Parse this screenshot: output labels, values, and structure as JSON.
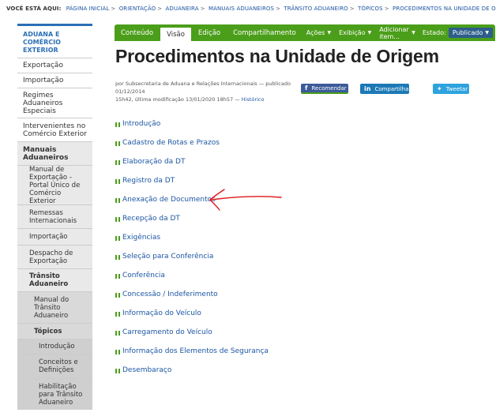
{
  "breadcrumb": {
    "label": "VOCÊ ESTÁ AQUI:",
    "items": [
      "PÁGINA INICIAL",
      "ORIENTAÇÃO",
      "ADUANEIRA",
      "MANUAIS ADUANEIROS",
      "TRÂNSITO ADUANEIRO",
      "TÓPICOS",
      "PROCEDIMENTOS NA UNIDADE DE ORIGEM"
    ],
    "separator": ">"
  },
  "sidebar": {
    "header": "ADUANA E COMÉRCIO EXTERIOR",
    "items": [
      {
        "label": "Exportação"
      },
      {
        "label": "Importação"
      },
      {
        "label": "Regimes Aduaneiros Especiais"
      },
      {
        "label": "Intervenientes no Comércio Exterior"
      },
      {
        "label": "Manuais Aduaneiros"
      },
      {
        "label": "Manual de Exportação - Portal Único de Comércio Exterior"
      },
      {
        "label": "Remessas Internacionais"
      },
      {
        "label": "Importação"
      },
      {
        "label": "Despacho de Exportação"
      },
      {
        "label": "Trânsito Aduaneiro"
      },
      {
        "label": "Manual do Trânsito Aduaneiro"
      },
      {
        "label": "Tópicos"
      },
      {
        "label": "Introdução"
      },
      {
        "label": "Conceitos e Definições"
      },
      {
        "label": "Habilitação para Trânsito Aduaneiro"
      }
    ]
  },
  "tabs": {
    "conteudo": "Conteúdo",
    "visao": "Visão",
    "edicao": "Edição",
    "compartilhamento": "Compartilhamento",
    "acoes": "Ações",
    "exibicao": "Exibição",
    "adicionar": "Adicionar item...",
    "estado_label": "Estado:",
    "estado_value": "Publicado",
    "caret": "▼"
  },
  "page": {
    "title": "Procedimentos na Unidade de Origem",
    "byline_1": "por Subsecretaria de Aduana e Relações Internacionais — publicado 01/12/2014",
    "byline_2": "15h42, última modificação 13/01/2020 18h57 —",
    "history": "Histórico"
  },
  "social": {
    "fb_icon": "f",
    "fb": "Recomendar",
    "li_icon": "in",
    "li": "Compartilhar",
    "tw_icon": "✦",
    "tw": "Tweetar"
  },
  "links": [
    "Introdução",
    "Cadastro de Rotas e Prazos",
    "Elaboração da DT",
    "Registro da DT",
    "Anexação de Documentos",
    "Recepção da DT",
    "Exigências",
    "Seleção para Conferência",
    "Conferência",
    "Concessão / Indeferimento",
    "Informação do Veículo",
    "Carregamento do Veículo",
    "Informação dos Elementos de Segurança",
    "Desembaraço"
  ],
  "colors": {
    "tab_green": "#4b9e1a",
    "link_blue": "#1c56a3",
    "annotation_red": "#e0161b"
  }
}
